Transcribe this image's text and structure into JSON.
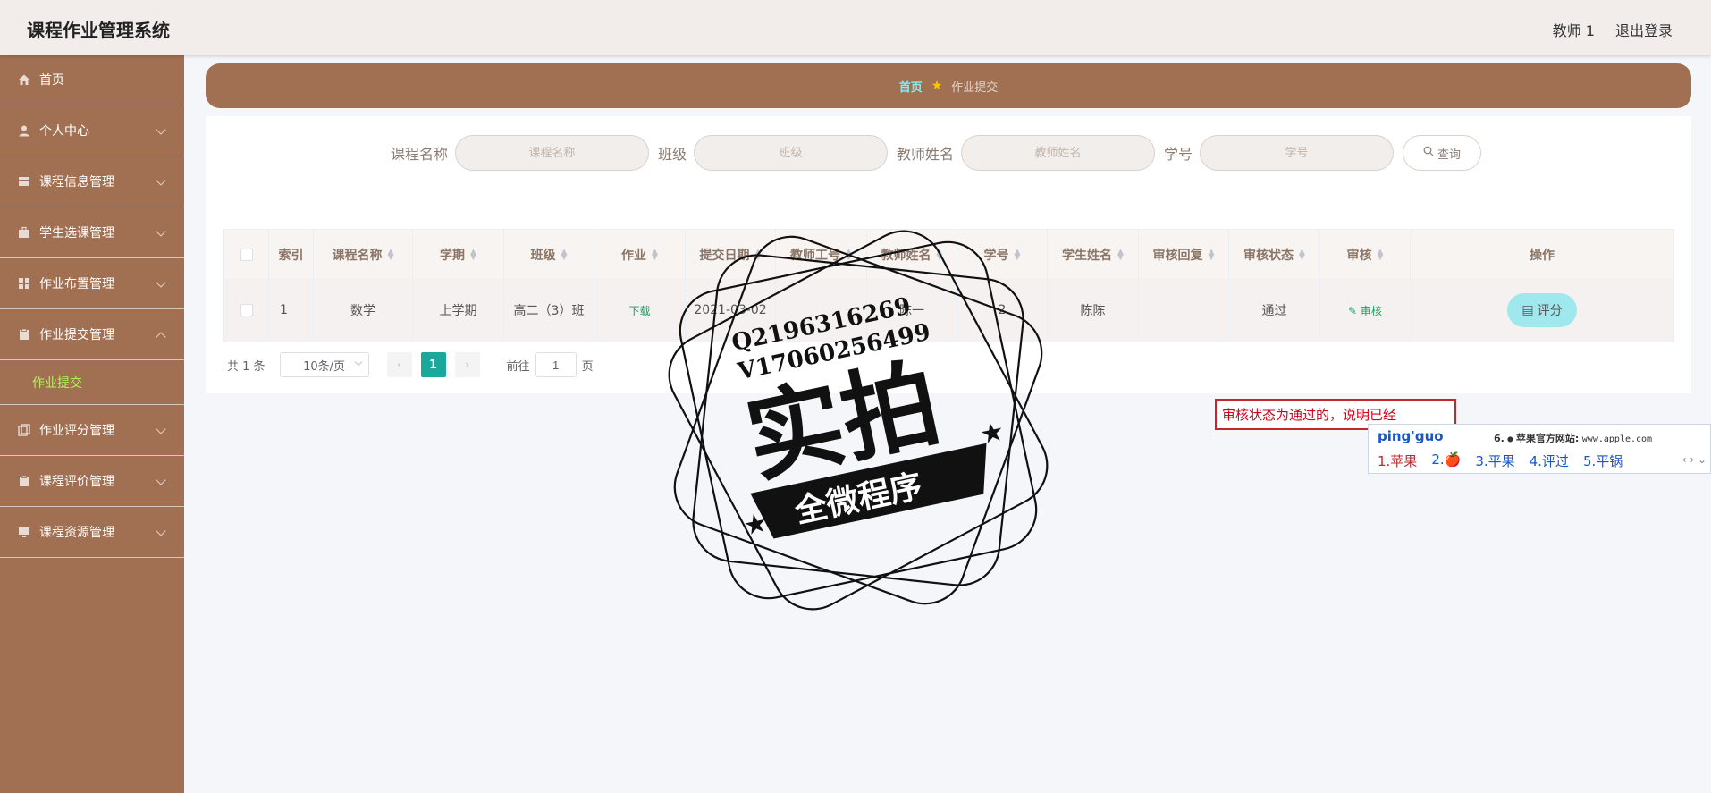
{
  "header": {
    "app_title": "课程作业管理系统",
    "user": "教师 1",
    "logout": "退出登录"
  },
  "sidebar": {
    "items": [
      {
        "label": "首页",
        "icon": "home-icon"
      },
      {
        "label": "个人中心",
        "icon": "user-icon"
      },
      {
        "label": "课程信息管理",
        "icon": "course-icon"
      },
      {
        "label": "学生选课管理",
        "icon": "briefcase-icon"
      },
      {
        "label": "作业布置管理",
        "icon": "grid-icon"
      },
      {
        "label": "作业提交管理",
        "icon": "clipboard-icon"
      },
      {
        "label": "作业评分管理",
        "icon": "copy-icon"
      },
      {
        "label": "课程评价管理",
        "icon": "clipboard-icon"
      },
      {
        "label": "课程资源管理",
        "icon": "monitor-icon"
      }
    ],
    "active_sub": "作业提交"
  },
  "breadcrumb": {
    "home": "首页",
    "current": "作业提交"
  },
  "search": {
    "fields": [
      {
        "label": "课程名称",
        "placeholder": "课程名称"
      },
      {
        "label": "班级",
        "placeholder": "班级"
      },
      {
        "label": "教师姓名",
        "placeholder": "教师姓名"
      },
      {
        "label": "学号",
        "placeholder": "学号"
      }
    ],
    "button": "查询"
  },
  "table": {
    "headers": [
      "索引",
      "课程名称",
      "学期",
      "班级",
      "作业",
      "提交日期",
      "教师工号",
      "教师姓名",
      "学号",
      "学生姓名",
      "审核回复",
      "审核状态",
      "审核",
      "操作"
    ],
    "rows": [
      {
        "index": "1",
        "course": "数学",
        "term": "上学期",
        "class": "高二（3）班",
        "homework": "下载",
        "date": "2021-03-02",
        "teacher_id": "",
        "teacher_name": "陈一",
        "student_id": "2",
        "student_name": "陈陈",
        "reply": "",
        "status": "通过",
        "review": "审核",
        "action": "评分"
      }
    ]
  },
  "pagination": {
    "total": "共 1 条",
    "page_size": "10条/页",
    "current_page": "1",
    "goto_prefix": "前往",
    "goto_value": "1",
    "goto_suffix": "页"
  },
  "watermark": {
    "line1": "Q2196316269",
    "line2": "V17060256499",
    "big": "实拍",
    "ribbon": "全微程序"
  },
  "annotation": {
    "text": "审核状态为通过的，说明已经"
  },
  "ime": {
    "composition": "ping'guo",
    "hint_prefix": "6.",
    "hint_text": "苹果官方网站:",
    "hint_url": "www.apple.com",
    "candidates": [
      "1.苹果",
      "2.🍎",
      "3.平果",
      "4.评过",
      "5.平锅"
    ]
  }
}
